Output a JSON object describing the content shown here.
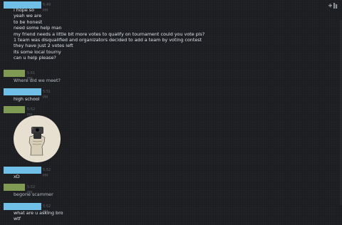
{
  "colors": {
    "user_a_name_bar": "#6fbfe7",
    "user_b_name_bar": "#7f9a52",
    "text": "#dfe3ea",
    "timestamp": "#5b6068",
    "background": "#1b1d21"
  },
  "messages": [
    {
      "sender": "a",
      "time": "5:49 PM",
      "lines": [
        "i hope so",
        "yeah we are",
        "to be honest",
        "need some help man",
        "my friend needs a little bit more votes to qualify on tournament could you vote pls?",
        "1 team was disqualified and organizators decided to add a team by voting contest",
        "they have just 2 votes left",
        "its some local tourny",
        "can u help please?"
      ]
    },
    {
      "sender": "b",
      "time": "5:51 PM",
      "lines": [
        "Where did we meet?"
      ]
    },
    {
      "sender": "a",
      "time": "5:51 PM",
      "lines": [
        "high school"
      ]
    },
    {
      "sender": "b",
      "time": "5:52 PM",
      "lines": [],
      "image_icon": "gun-pointing-at-viewer-icon"
    },
    {
      "sender": "a",
      "time": "5:52 PM",
      "lines": [
        "xD"
      ]
    },
    {
      "sender": "b",
      "time": "5:52 PM",
      "lines": [
        "begone scammer"
      ]
    },
    {
      "sender": "a",
      "time": "5:52 PM",
      "lines": [
        "what are u asking bro",
        "wtf"
      ]
    }
  ],
  "icons": {
    "top_right": "add-friend-icon"
  }
}
